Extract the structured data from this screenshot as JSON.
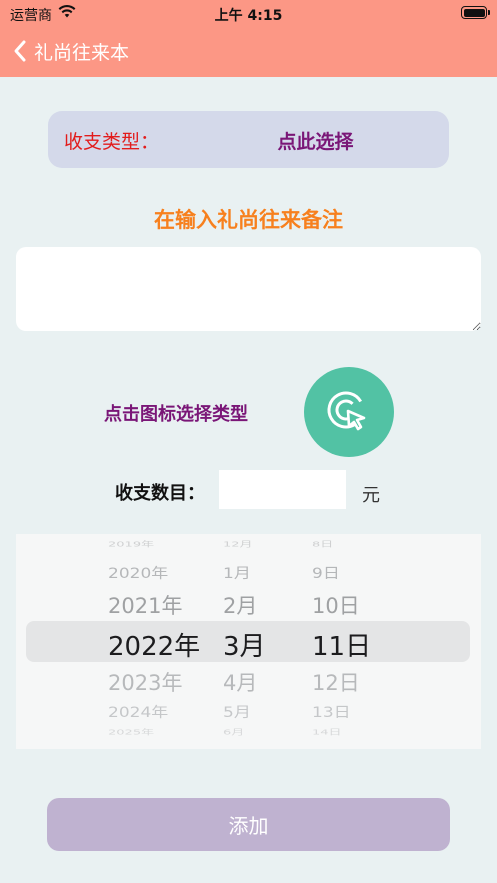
{
  "status_bar": {
    "carrier": "运营商",
    "time": "上午 4:15",
    "battery_level": 1.0
  },
  "nav": {
    "title": "礼尚往来本",
    "back_icon": "chevron-left-icon"
  },
  "type_selector": {
    "label": "收支类型：",
    "action": "点此选择"
  },
  "note": {
    "heading": "在输入礼尚往来备注",
    "value": ""
  },
  "icon_picker": {
    "hint": "点击图标选择类型",
    "icon": "tap-cursor-icon"
  },
  "amount": {
    "label": "收支数目：",
    "value": "",
    "unit": "元"
  },
  "date_picker": {
    "years": [
      "2019年",
      "2020年",
      "2021年",
      "2022年",
      "2023年",
      "2024年",
      "2025年"
    ],
    "months": [
      "12月",
      "1月",
      "2月",
      "3月",
      "4月",
      "5月",
      "6月"
    ],
    "days": [
      "8日",
      "9日",
      "10日",
      "11日",
      "12日",
      "13日",
      "14日"
    ],
    "selected": {
      "year": "2022年",
      "month": "3月",
      "day": "11日"
    }
  },
  "submit": {
    "label": "添加"
  },
  "colors": {
    "nav_bg": "#fc9785",
    "type_label": "#e21c1c",
    "purple_text": "#7a1677",
    "note_heading": "#f7801e",
    "icon_button": "#52c2a4",
    "submit_bg": "#bfb2d0",
    "page_bg": "#e9f1f2"
  }
}
